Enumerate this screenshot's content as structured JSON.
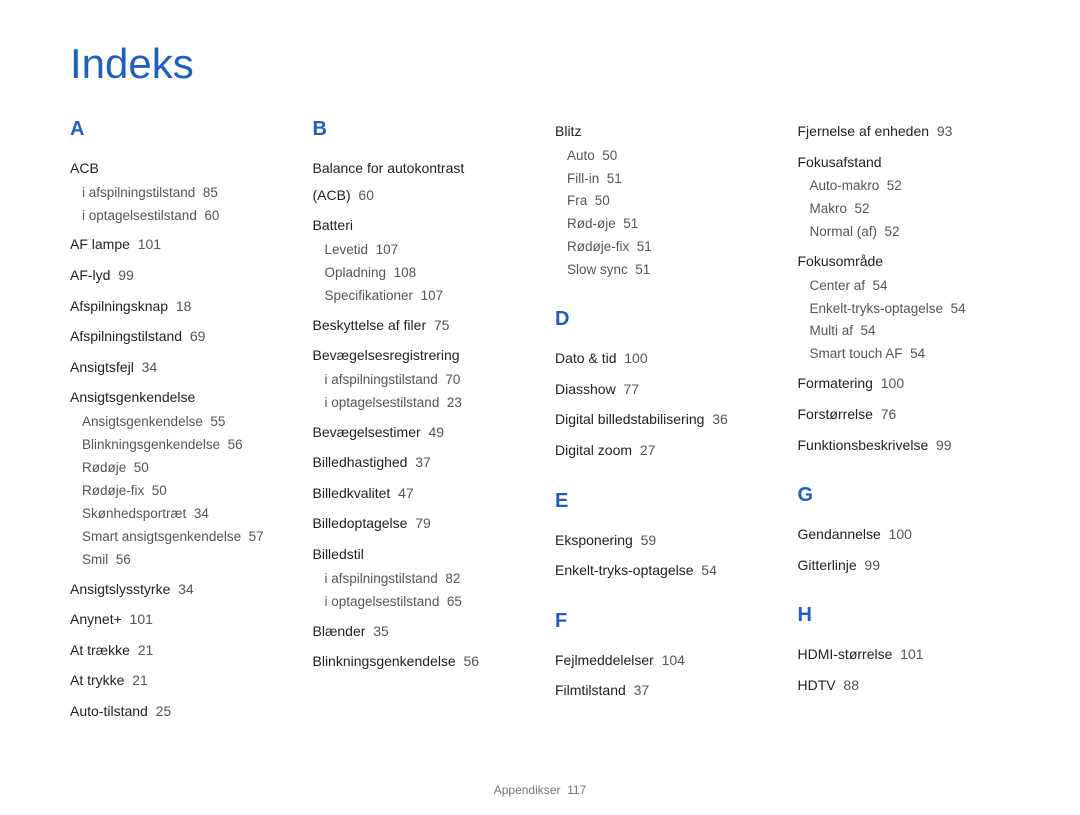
{
  "title": "Indeks",
  "footer": {
    "section": "Appendikser",
    "page": "117"
  },
  "col1": {
    "letter": "A",
    "items": [
      {
        "term": "ACB",
        "subs": [
          {
            "t": "i afspilningstilstand",
            "p": "85"
          },
          {
            "t": "i optagelsestilstand",
            "p": "60"
          }
        ]
      },
      {
        "term": "AF lampe",
        "p": "101"
      },
      {
        "term": "AF-lyd",
        "p": "99"
      },
      {
        "term": "Afspilningsknap",
        "p": "18"
      },
      {
        "term": "Afspilningstilstand",
        "p": "69"
      },
      {
        "term": "Ansigtsfejl",
        "p": "34"
      },
      {
        "term": "Ansigtsgenkendelse",
        "subs": [
          {
            "t": "Ansigtsgenkendelse",
            "p": "55"
          },
          {
            "t": "Blinkningsgenkendelse",
            "p": "56"
          },
          {
            "t": "Rødøje",
            "p": "50"
          },
          {
            "t": "Rødøje-fix",
            "p": "50"
          },
          {
            "t": "Skønhedsportræt",
            "p": "34"
          },
          {
            "t": "Smart ansigtsgenkendelse",
            "p": "57"
          },
          {
            "t": "Smil",
            "p": "56"
          }
        ]
      },
      {
        "term": "Ansigtslysstyrke",
        "p": "34"
      },
      {
        "term": "Anynet+",
        "p": "101"
      },
      {
        "term": "At trække",
        "p": "21"
      },
      {
        "term": "At trykke",
        "p": "21"
      },
      {
        "term": "Auto-tilstand",
        "p": "25"
      }
    ]
  },
  "col2": {
    "letter": "B",
    "items": [
      {
        "term": "Balance for autokontrast (ACB)",
        "p": "60"
      },
      {
        "term": "Batteri",
        "subs": [
          {
            "t": "Levetid",
            "p": "107"
          },
          {
            "t": "Opladning",
            "p": "108"
          },
          {
            "t": "Specifikationer",
            "p": "107"
          }
        ]
      },
      {
        "term": "Beskyttelse af filer",
        "p": "75"
      },
      {
        "term": "Bevægelsesregistrering",
        "subs": [
          {
            "t": "i afspilningstilstand",
            "p": "70"
          },
          {
            "t": "i optagelsestilstand",
            "p": "23"
          }
        ]
      },
      {
        "term": "Bevægelsestimer",
        "p": "49"
      },
      {
        "term": "Billedhastighed",
        "p": "37"
      },
      {
        "term": "Billedkvalitet",
        "p": "47"
      },
      {
        "term": "Billedoptagelse",
        "p": "79"
      },
      {
        "term": "Billedstil",
        "subs": [
          {
            "t": "i afspilningstilstand",
            "p": "82"
          },
          {
            "t": "i optagelsestilstand",
            "p": "65"
          }
        ]
      },
      {
        "term": "Blænder",
        "p": "35"
      },
      {
        "term": "Blinkningsgenkendelse",
        "p": "56"
      }
    ]
  },
  "col3": {
    "groups": [
      {
        "items": [
          {
            "term": "Blitz",
            "subs": [
              {
                "t": "Auto",
                "p": "50"
              },
              {
                "t": "Fill-in",
                "p": "51"
              },
              {
                "t": "Fra",
                "p": "50"
              },
              {
                "t": "Rød-øje",
                "p": "51"
              },
              {
                "t": "Rødøje-fix",
                "p": "51"
              },
              {
                "t": "Slow sync",
                "p": "51"
              }
            ]
          }
        ]
      },
      {
        "letter": "D",
        "items": [
          {
            "term": "Dato & tid",
            "p": "100"
          },
          {
            "term": "Diasshow",
            "p": "77"
          },
          {
            "term": "Digital billedstabilisering",
            "p": "36"
          },
          {
            "term": "Digital zoom",
            "p": "27"
          }
        ]
      },
      {
        "letter": "E",
        "items": [
          {
            "term": "Eksponering",
            "p": "59"
          },
          {
            "term": "Enkelt-tryks-optagelse",
            "p": "54"
          }
        ]
      },
      {
        "letter": "F",
        "items": [
          {
            "term": "Fejlmeddelelser",
            "p": "104"
          },
          {
            "term": "Filmtilstand",
            "p": "37"
          }
        ]
      }
    ]
  },
  "col4": {
    "groups": [
      {
        "items": [
          {
            "term": "Fjernelse af enheden",
            "p": "93"
          },
          {
            "term": "Fokusafstand",
            "subs": [
              {
                "t": "Auto-makro",
                "p": "52"
              },
              {
                "t": "Makro",
                "p": "52"
              },
              {
                "t": "Normal (af)",
                "p": "52"
              }
            ]
          },
          {
            "term": "Fokusområde",
            "subs": [
              {
                "t": "Center af",
                "p": "54"
              },
              {
                "t": "Enkelt-tryks-optagelse",
                "p": "54"
              },
              {
                "t": "Multi af",
                "p": "54"
              },
              {
                "t": "Smart touch AF",
                "p": "54"
              }
            ]
          },
          {
            "term": "Formatering",
            "p": "100"
          },
          {
            "term": "Forstørrelse",
            "p": "76"
          },
          {
            "term": "Funktionsbeskrivelse",
            "p": "99"
          }
        ]
      },
      {
        "letter": "G",
        "items": [
          {
            "term": "Gendannelse",
            "p": "100"
          },
          {
            "term": "Gitterlinje",
            "p": "99"
          }
        ]
      },
      {
        "letter": "H",
        "items": [
          {
            "term": "HDMI-størrelse",
            "p": "101"
          },
          {
            "term": "HDTV",
            "p": "88"
          }
        ]
      }
    ]
  }
}
